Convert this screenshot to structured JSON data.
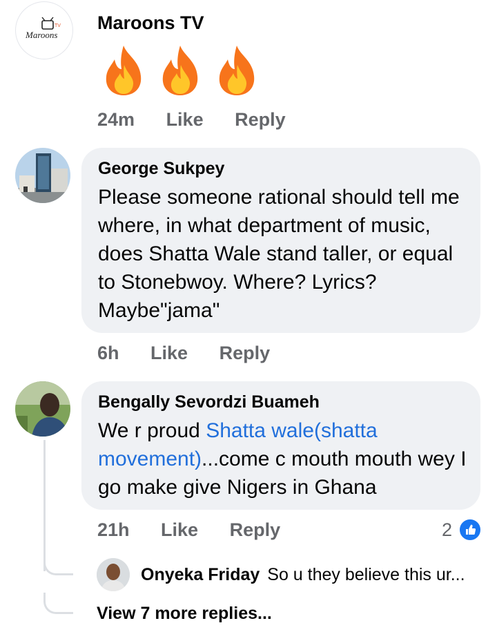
{
  "comments": [
    {
      "author": "Maroons TV",
      "avatar_logo_text": "Maroons",
      "avatar_logo_badge": "TV",
      "content_emoji": "🔥🔥🔥",
      "time": "24m",
      "like_label": "Like",
      "reply_label": "Reply"
    },
    {
      "author": "George Sukpey",
      "text": "Please someone rational should tell me where, in what department of music, does Shatta Wale stand taller, or equal to Stonebwoy. Where? Lyrics? Maybe\"jama\"",
      "time": "6h",
      "like_label": "Like",
      "reply_label": "Reply"
    },
    {
      "author": "Bengally Sevordzi Buameh",
      "text_before": "We r proud ",
      "tagged": "Shatta wale(shatta movement)",
      "text_after": "...come c mouth mouth wey I go make give Nigers in Ghana",
      "time": "21h",
      "like_label": "Like",
      "reply_label": "Reply",
      "reaction_count": "2",
      "reaction_icon": "like-icon",
      "replies": [
        {
          "author": "Onyeka Friday",
          "text": "So u they believe this ur..."
        }
      ],
      "view_more": "View 7 more replies..."
    }
  ],
  "colors": {
    "bubble": "#eff1f4",
    "meta": "#65676b",
    "link": "#216fdb",
    "like_blue": "#1877f2"
  }
}
